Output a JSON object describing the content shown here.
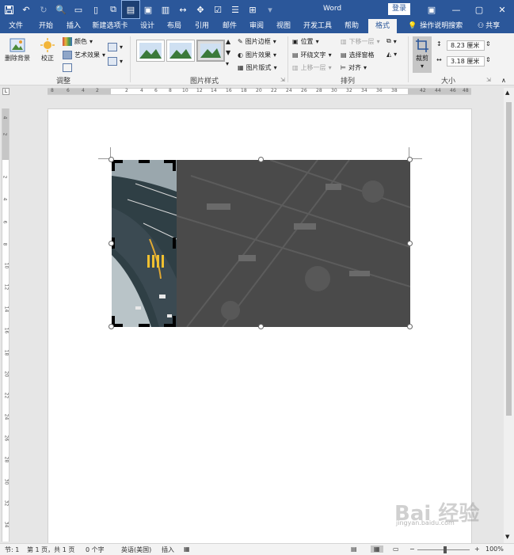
{
  "titlebar": {
    "doc_title": "Word",
    "login": "登录"
  },
  "tabs": [
    "文件",
    "开始",
    "插入",
    "新建选项卡",
    "设计",
    "布局",
    "引用",
    "邮件",
    "审阅",
    "视图",
    "开发工具",
    "帮助",
    "格式"
  ],
  "active_tab": "格式",
  "search": {
    "label": "操作说明搜索"
  },
  "share": {
    "label": "共享"
  },
  "ribbon": {
    "remove_bg": "删除背景",
    "correct": "校正",
    "color": "颜色",
    "art_effect": "艺术效果",
    "group_adjust": "调整",
    "pic_border": "图片边框",
    "pic_effect": "图片效果",
    "pic_layout": "图片版式",
    "group_style": "图片样式",
    "position": "位置",
    "wrap_text": "环绕文字",
    "bring_forward": "上移一层",
    "send_backward": "下移一层",
    "select_pane": "选择窗格",
    "align": "对齐",
    "group_arrange": "排列",
    "crop": "裁剪",
    "height": "8.23 厘米",
    "width": "3.18 厘米",
    "group_size": "大小"
  },
  "ruler": {
    "h_left": [
      "8",
      "6",
      "4",
      "2"
    ],
    "h_right": [
      "2",
      "4",
      "6",
      "8",
      "10",
      "12",
      "14",
      "16",
      "18",
      "20",
      "22",
      "24",
      "26",
      "28",
      "30",
      "32",
      "34",
      "36",
      "38"
    ],
    "h_far": [
      "42",
      "44",
      "46",
      "48"
    ],
    "v_top": [
      "4",
      "2"
    ],
    "v_nums": [
      "2",
      "4",
      "6",
      "8",
      "10",
      "12",
      "14",
      "16",
      "18",
      "20",
      "22",
      "24",
      "26",
      "28",
      "30",
      "32",
      "34"
    ]
  },
  "status": {
    "section": "节: 1",
    "page": "第 1 页，共 1 页",
    "words": "0 个字",
    "language": "英语(美国)",
    "mode": "插入",
    "zoom": "100%"
  },
  "watermark": {
    "brand": "Bai 经验",
    "url": "jingyan.baidu.com"
  },
  "colors": {
    "brand": "#2b579a",
    "ribbon": "#f3f3f3"
  }
}
